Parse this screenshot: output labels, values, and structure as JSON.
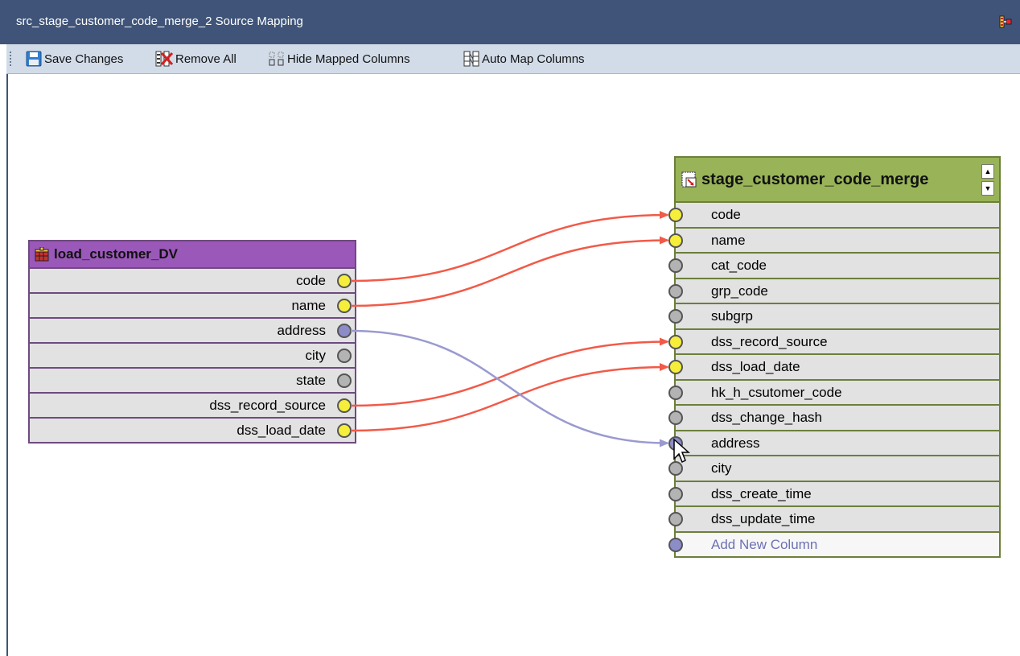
{
  "window": {
    "title": "src_stage_customer_code_merge_2 Source Mapping",
    "corner_icon": "mapping-icon"
  },
  "toolbar": {
    "save_label": "Save Changes",
    "remove_label": "Remove All",
    "hide_label": "Hide Mapped Columns",
    "auto_label": "Auto Map Columns"
  },
  "source_table": {
    "name": "load_customer_DV",
    "columns": [
      {
        "name": "code",
        "status": "mapped"
      },
      {
        "name": "name",
        "status": "mapped"
      },
      {
        "name": "address",
        "status": "selected"
      },
      {
        "name": "city",
        "status": "unmapped"
      },
      {
        "name": "state",
        "status": "unmapped"
      },
      {
        "name": "dss_record_source",
        "status": "mapped"
      },
      {
        "name": "dss_load_date",
        "status": "mapped"
      }
    ]
  },
  "target_table": {
    "name": "stage_customer_code_merge",
    "columns": [
      {
        "name": "code",
        "status": "mapped"
      },
      {
        "name": "name",
        "status": "mapped"
      },
      {
        "name": "cat_code",
        "status": "unmapped"
      },
      {
        "name": "grp_code",
        "status": "unmapped"
      },
      {
        "name": "subgrp",
        "status": "unmapped"
      },
      {
        "name": "dss_record_source",
        "status": "mapped"
      },
      {
        "name": "dss_load_date",
        "status": "mapped"
      },
      {
        "name": "hk_h_csutomer_code",
        "status": "unmapped"
      },
      {
        "name": "dss_change_hash",
        "status": "unmapped"
      },
      {
        "name": "address",
        "status": "selected"
      },
      {
        "name": "city",
        "status": "unmapped"
      },
      {
        "name": "dss_create_time",
        "status": "unmapped"
      },
      {
        "name": "dss_update_time",
        "status": "unmapped"
      }
    ],
    "add_new_label": "Add New Column"
  },
  "mappings": [
    {
      "from": "code",
      "to": "code",
      "kind": "mapped"
    },
    {
      "from": "name",
      "to": "name",
      "kind": "mapped"
    },
    {
      "from": "dss_record_source",
      "to": "dss_record_source",
      "kind": "mapped"
    },
    {
      "from": "dss_load_date",
      "to": "dss_load_date",
      "kind": "mapped"
    },
    {
      "from": "address",
      "to": "address",
      "kind": "pending"
    }
  ],
  "colors": {
    "mapped_dot": "#f5ee3a",
    "unmapped_dot": "#b3b3b3",
    "selected_dot": "#8c8cc8",
    "mapped_wire": "#f25a48",
    "pending_wire": "#9a9ad0"
  }
}
